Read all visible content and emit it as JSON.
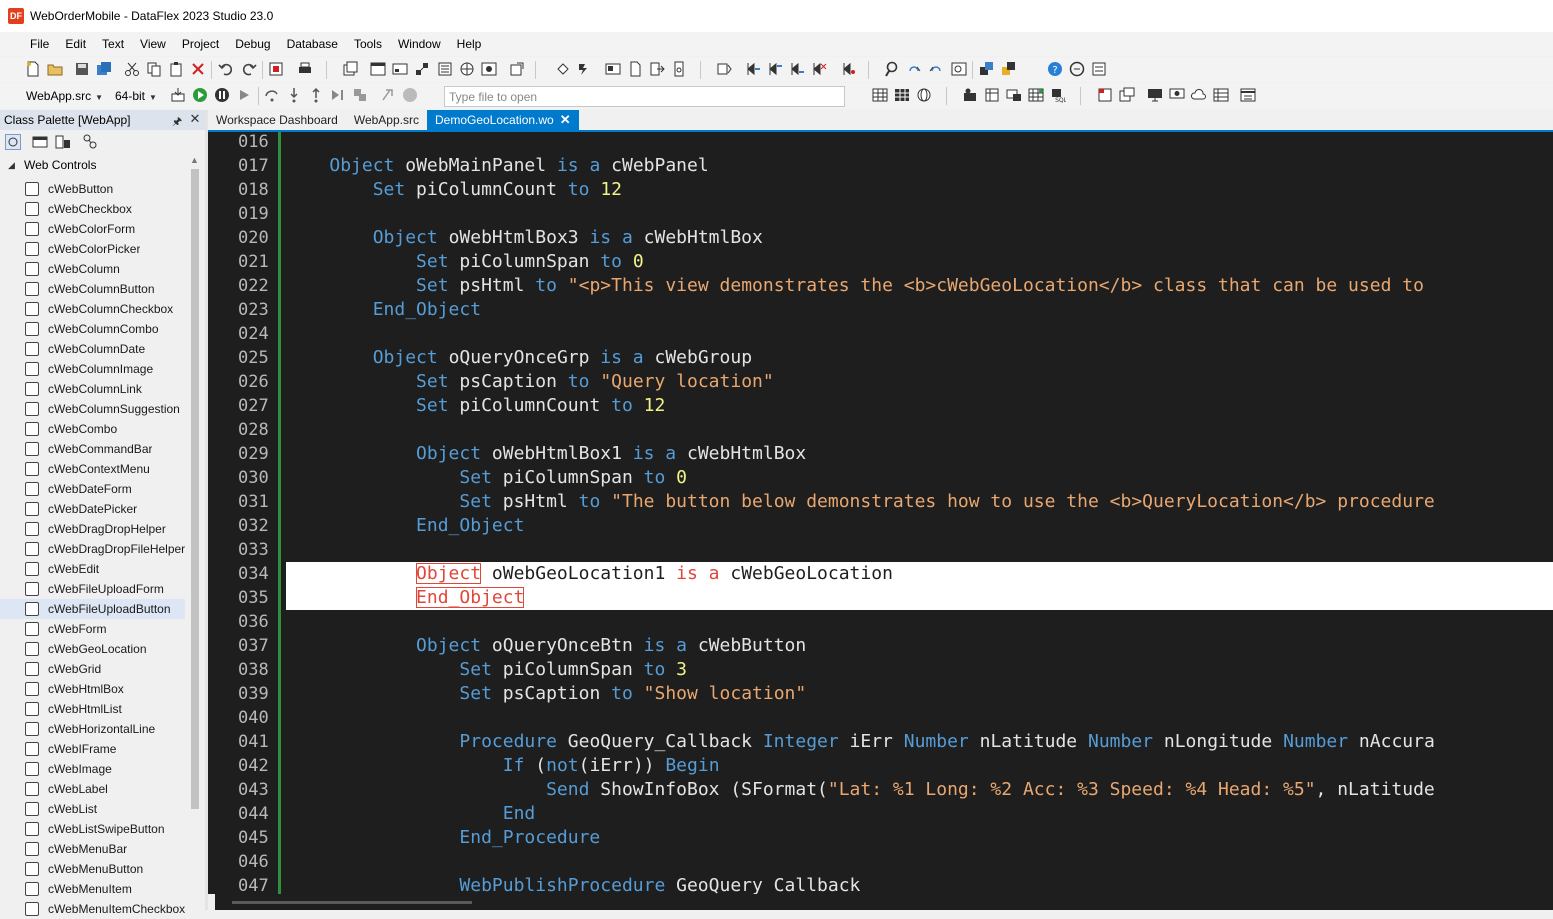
{
  "window": {
    "title": "WebOrderMobile - DataFlex 2023 Studio 23.0",
    "app_icon_text": "DF"
  },
  "menu": [
    "File",
    "Edit",
    "Text",
    "View",
    "Project",
    "Debug",
    "Database",
    "Tools",
    "Window",
    "Help"
  ],
  "toolbar": {
    "project_combo": "WebApp.src",
    "bitness_combo": "64-bit",
    "file_open_placeholder": "Type file to open"
  },
  "palette": {
    "title": "Class Palette [WebApp]",
    "group": "Web Controls",
    "selected": "cWebFileUploadButton",
    "items": [
      "cWebButton",
      "cWebCheckbox",
      "cWebColorForm",
      "cWebColorPicker",
      "cWebColumn",
      "cWebColumnButton",
      "cWebColumnCheckbox",
      "cWebColumnCombo",
      "cWebColumnDate",
      "cWebColumnImage",
      "cWebColumnLink",
      "cWebColumnSuggestion",
      "cWebCombo",
      "cWebCommandBar",
      "cWebContextMenu",
      "cWebDateForm",
      "cWebDatePicker",
      "cWebDragDropHelper",
      "cWebDragDropFileHelper",
      "cWebEdit",
      "cWebFileUploadForm",
      "cWebFileUploadButton",
      "cWebForm",
      "cWebGeoLocation",
      "cWebGrid",
      "cWebHtmlBox",
      "cWebHtmlList",
      "cWebHorizontalLine",
      "cWebIFrame",
      "cWebImage",
      "cWebLabel",
      "cWebList",
      "cWebListSwipeButton",
      "cWebMenuBar",
      "cWebMenuButton",
      "cWebMenuItem",
      "cWebMenuItemCheckbox"
    ]
  },
  "tabs": [
    {
      "label": "Workspace Dashboard",
      "active": false
    },
    {
      "label": "WebApp.src",
      "active": false
    },
    {
      "label": "DemoGeoLocation.wo",
      "active": true
    }
  ],
  "editor": {
    "line_numbers": [
      "016",
      "017",
      "018",
      "019",
      "020",
      "021",
      "022",
      "023",
      "024",
      "025",
      "026",
      "027",
      "028",
      "029",
      "030",
      "031",
      "032",
      "033",
      "034",
      "035",
      "036",
      "037",
      "038",
      "039",
      "040",
      "041",
      "042",
      "043",
      "044",
      "045",
      "046",
      "047"
    ],
    "lines": [
      [],
      [
        [
          "    ",
          ""
        ],
        [
          "Object",
          "kw"
        ],
        [
          " oWebMainPanel ",
          ""
        ],
        [
          "is a",
          "kw"
        ],
        [
          " cWebPanel",
          ""
        ]
      ],
      [
        [
          "        ",
          ""
        ],
        [
          "Set",
          "kw"
        ],
        [
          " piColumnCount ",
          ""
        ],
        [
          "to",
          "kw"
        ],
        [
          " ",
          ""
        ],
        [
          "12",
          "num"
        ]
      ],
      [],
      [
        [
          "        ",
          ""
        ],
        [
          "Object",
          "kw"
        ],
        [
          " oWebHtmlBox3 ",
          ""
        ],
        [
          "is a",
          "kw"
        ],
        [
          " cWebHtmlBox",
          ""
        ]
      ],
      [
        [
          "            ",
          ""
        ],
        [
          "Set",
          "kw"
        ],
        [
          " piColumnSpan ",
          ""
        ],
        [
          "to",
          "kw"
        ],
        [
          " ",
          ""
        ],
        [
          "0",
          "num"
        ]
      ],
      [
        [
          "            ",
          ""
        ],
        [
          "Set",
          "kw"
        ],
        [
          " psHtml ",
          ""
        ],
        [
          "to",
          "kw"
        ],
        [
          " ",
          ""
        ],
        [
          "\"<p>This view demonstrates the <b>cWebGeoLocation</b> class that can be used to",
          "str"
        ]
      ],
      [
        [
          "        ",
          ""
        ],
        [
          "End_Object",
          "kw"
        ]
      ],
      [],
      [
        [
          "        ",
          ""
        ],
        [
          "Object",
          "kw"
        ],
        [
          " oQueryOnceGrp ",
          ""
        ],
        [
          "is a",
          "kw"
        ],
        [
          " cWebGroup",
          ""
        ]
      ],
      [
        [
          "            ",
          ""
        ],
        [
          "Set",
          "kw"
        ],
        [
          " psCaption ",
          ""
        ],
        [
          "to",
          "kw"
        ],
        [
          " ",
          ""
        ],
        [
          "\"Query location\"",
          "str"
        ]
      ],
      [
        [
          "            ",
          ""
        ],
        [
          "Set",
          "kw"
        ],
        [
          " piColumnCount ",
          ""
        ],
        [
          "to",
          "kw"
        ],
        [
          " ",
          ""
        ],
        [
          "12",
          "num"
        ]
      ],
      [],
      [
        [
          "            ",
          ""
        ],
        [
          "Object",
          "kw"
        ],
        [
          " oWebHtmlBox1 ",
          ""
        ],
        [
          "is a",
          "kw"
        ],
        [
          " cWebHtmlBox",
          ""
        ]
      ],
      [
        [
          "                ",
          ""
        ],
        [
          "Set",
          "kw"
        ],
        [
          " piColumnSpan ",
          ""
        ],
        [
          "to",
          "kw"
        ],
        [
          " ",
          ""
        ],
        [
          "0",
          "num"
        ]
      ],
      [
        [
          "                ",
          ""
        ],
        [
          "Set",
          "kw"
        ],
        [
          " psHtml ",
          ""
        ],
        [
          "to",
          "kw"
        ],
        [
          " ",
          ""
        ],
        [
          "\"The button below demonstrates how to use the <b>QueryLocation</b> procedure",
          "str"
        ]
      ],
      [
        [
          "            ",
          ""
        ],
        [
          "End_Object",
          "kw"
        ]
      ],
      [],
      [
        [
          "            ",
          ""
        ],
        [
          "Object",
          "sel"
        ],
        [
          " oWebGeoLocation1 ",
          ""
        ],
        [
          "is a",
          "kw2"
        ],
        [
          " cWebGeoLocation",
          ""
        ]
      ],
      [
        [
          "            ",
          ""
        ],
        [
          "End_Object",
          "sel"
        ]
      ],
      [],
      [
        [
          "            ",
          ""
        ],
        [
          "Object",
          "kw"
        ],
        [
          " oQueryOnceBtn ",
          ""
        ],
        [
          "is a",
          "kw"
        ],
        [
          " cWebButton",
          ""
        ]
      ],
      [
        [
          "                ",
          ""
        ],
        [
          "Set",
          "kw"
        ],
        [
          " piColumnSpan ",
          ""
        ],
        [
          "to",
          "kw"
        ],
        [
          " ",
          ""
        ],
        [
          "3",
          "num"
        ]
      ],
      [
        [
          "                ",
          ""
        ],
        [
          "Set",
          "kw"
        ],
        [
          " psCaption ",
          ""
        ],
        [
          "to",
          "kw"
        ],
        [
          " ",
          ""
        ],
        [
          "\"Show location\"",
          "str"
        ]
      ],
      [],
      [
        [
          "                ",
          ""
        ],
        [
          "Procedure",
          "kw"
        ],
        [
          " GeoQuery_Callback ",
          ""
        ],
        [
          "Integer",
          "kw"
        ],
        [
          " iErr ",
          ""
        ],
        [
          "Number",
          "kw"
        ],
        [
          " nLatitude ",
          ""
        ],
        [
          "Number",
          "kw"
        ],
        [
          " nLongitude ",
          ""
        ],
        [
          "Number",
          "kw"
        ],
        [
          " nAccura",
          ""
        ]
      ],
      [
        [
          "                    ",
          ""
        ],
        [
          "If",
          "kw"
        ],
        [
          " (",
          ""
        ],
        [
          "not",
          "kw"
        ],
        [
          "(iErr)) ",
          ""
        ],
        [
          "Begin",
          "kw"
        ]
      ],
      [
        [
          "                        ",
          ""
        ],
        [
          "Send",
          "kw"
        ],
        [
          " ShowInfoBox (SFormat(",
          ""
        ],
        [
          "\"Lat: %1 Long: %2 Acc: %3 Speed: %4 Head: %5\"",
          "str"
        ],
        [
          ", nLatitude",
          ""
        ]
      ],
      [
        [
          "                    ",
          ""
        ],
        [
          "End",
          "kw"
        ]
      ],
      [
        [
          "                ",
          ""
        ],
        [
          "End_Procedure",
          "kw"
        ]
      ],
      [],
      [
        [
          "                ",
          ""
        ],
        [
          "WebPublishProcedure",
          "kw"
        ],
        [
          " GeoQuery_Callback",
          ""
        ]
      ]
    ]
  }
}
